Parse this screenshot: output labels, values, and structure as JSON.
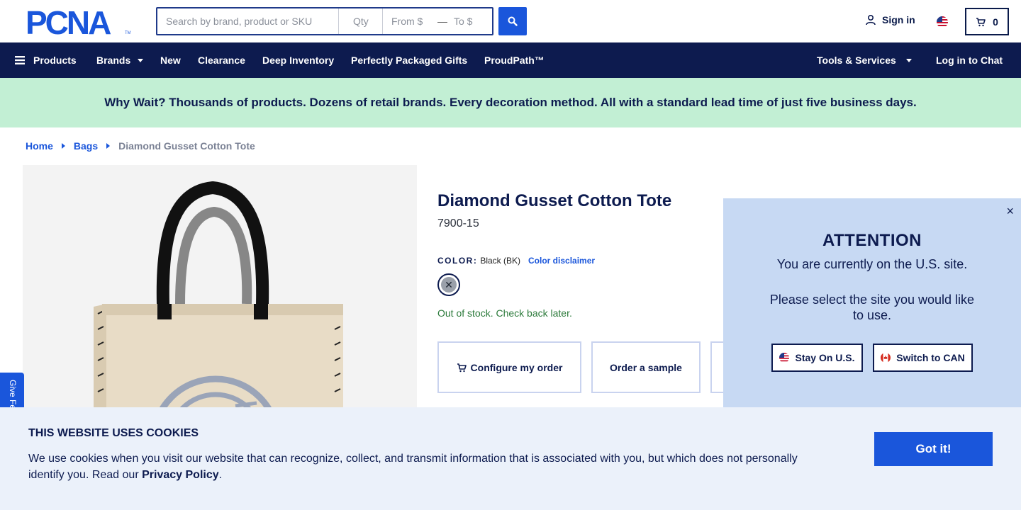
{
  "header": {
    "logo_text": "PCNA",
    "search_placeholder": "Search by brand, product or SKU",
    "qty_placeholder": "Qty",
    "from_placeholder": "From $",
    "range_dash": "—",
    "to_placeholder": "To $",
    "signin_label": "Sign in",
    "cart_count": "0"
  },
  "nav": {
    "products": "Products",
    "brands": "Brands",
    "new": "New",
    "clearance": "Clearance",
    "deep_inventory": "Deep Inventory",
    "gifts": "Perfectly Packaged Gifts",
    "proudpath": "ProudPath™",
    "tools": "Tools & Services",
    "chat": "Log in to Chat"
  },
  "banner": {
    "text": "Why Wait? Thousands of products. Dozens of retail brands. Every decoration method. All with a standard lead time of just five business days."
  },
  "breadcrumb": {
    "home": "Home",
    "bags": "Bags",
    "current": "Diamond Gusset Cotton Tote"
  },
  "product": {
    "title": "Diamond Gusset Cotton Tote",
    "sku": "7900-15",
    "color_label": "COLOR:",
    "color_value": "Black (BK)",
    "color_disclaimer": "Color disclaimer",
    "swatch_mark": "✕",
    "stock_status": "Out of stock. Check back later.",
    "configure_label": "Configure my order",
    "sample_label": "Order a sample"
  },
  "attention": {
    "close": "×",
    "title": "ATTENTION",
    "line1": "You are currently on the U.S. site.",
    "line2": "Please select the site you would like to use.",
    "stay_label": "Stay On U.S.",
    "switch_label": "Switch to CAN"
  },
  "feedback": {
    "label": "Give Feedback"
  },
  "cookie": {
    "title": "THIS WEBSITE USES COOKIES",
    "text": "We use cookies when you visit our website that can recognize, collect, and transmit information that is associated with you, but which does not personally identify you. Read our",
    "privacy_link": "Privacy Policy",
    "period": ".",
    "button": "Got it!"
  },
  "colors": {
    "navy": "#0d1b4f",
    "accent_blue": "#1a56db",
    "banner_green": "#c2efd4",
    "modal_blue": "#c7d9f3",
    "cookie_bg": "#ebf1fa",
    "stock_green": "#2b7a3a"
  },
  "icons": {
    "search": "search-icon",
    "user": "user-icon",
    "cart": "cart-icon",
    "menu": "hamburger-icon",
    "close": "close-icon"
  }
}
